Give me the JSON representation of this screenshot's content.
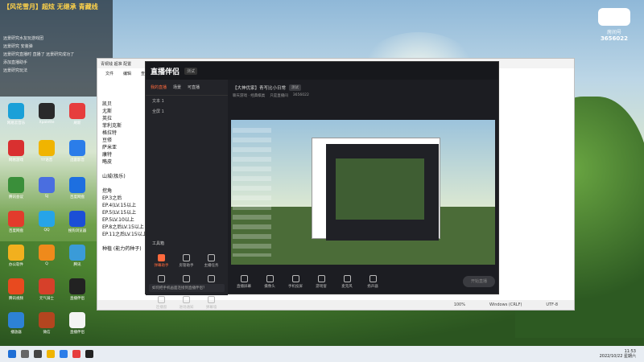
{
  "banner": {
    "title": "【风花雪月】超炫 无继承 青藏线",
    "lines": [
      "远景研究水友玩游戏团",
      "远景研究 安装弹",
      "远景研究直播时 直播了 远景研究成功了",
      "添加直播助手",
      "远景研究玩法"
    ]
  },
  "logo": {
    "tag": "房间号",
    "number": "3656022"
  },
  "desktop_icons": [
    "网易云音乐",
    "Xpalette",
    "刷新",
    "网易游戏",
    "YY语音",
    "迅雷影音",
    "腾讯会议",
    "SJ",
    "百度网盘",
    "百度网盘",
    "QQ",
    "搜狗浏览器",
    "办公软件",
    "Q",
    "腾讯",
    "腾讯视频",
    "元气骑士",
    "直播伴侣",
    "播放器",
    "微信",
    "直播伴侣"
  ],
  "notepad": {
    "title": "青铜钱 超准 配置",
    "menu": [
      "文件",
      "编辑",
      "查看"
    ],
    "lines": [
      "凯贝",
      "尤斯",
      "英拉",
      "菲利克斯",
      "格拉特",
      "豆修",
      "萨米亚",
      "康特",
      "略皮",
      "",
      "山城(极乐)",
      "",
      "挖角",
      "EP.3之后",
      "EP.4(LV.15以上",
      "EP.5(LV.15以上",
      "EP.5LV.10以上",
      "EP.8之后LV.15以上",
      "EP.11之后LV.15以上",
      "",
      "种植 (能力药种子)"
    ],
    "status": [
      "100%",
      "Windows (CRLF)",
      "UTF-8"
    ]
  },
  "app": {
    "name": "直播伴侣",
    "badge": "测试",
    "tabs": [
      "我的直播",
      "场景",
      "可直播"
    ],
    "scenes": [
      "文本 1",
      "全屏 1"
    ],
    "tool_heading": "工具箱",
    "tools": [
      "弹幕助手",
      "房管助手",
      "主播任务",
      "弹幕",
      "送入直播",
      "粉丝助手",
      "连播窗",
      "进场通知",
      "弹幕墙",
      "直播"
    ],
    "hint": "如何把手机画面连接到直播伴侣？",
    "room_title": "【大神优家】青写比小日常",
    "room_pill": "测试",
    "room_tags": [
      "聊天游戏 · 经典棋类",
      "只是直播间",
      "3656022"
    ],
    "bottom_tools": [
      "直播屏幕",
      "摄像头",
      "手机投屏",
      "游戏窗",
      "麦克风",
      "扬声器"
    ],
    "start_label": "开始直播"
  },
  "taskbar": {
    "time": "11:53",
    "date": "2022/10/22 星期六"
  }
}
